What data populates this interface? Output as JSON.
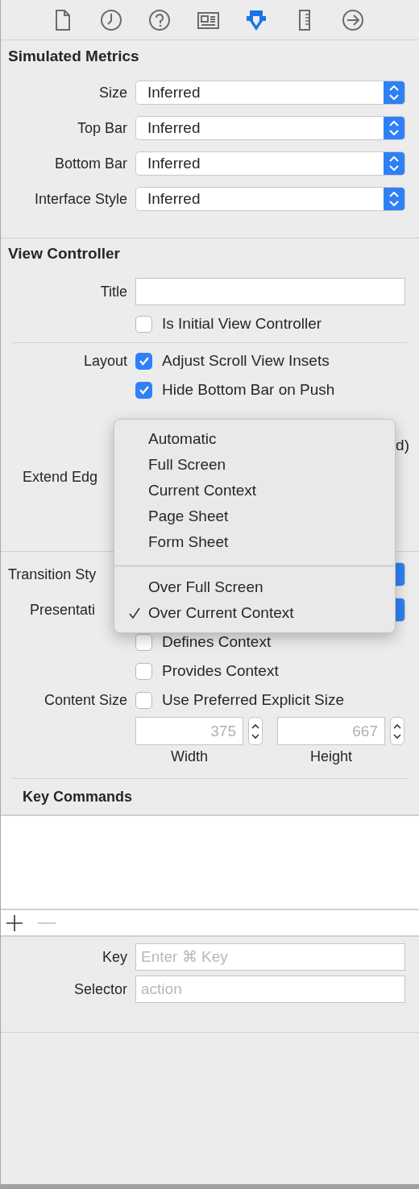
{
  "toolbar": [
    {
      "kind": "file",
      "selected": false
    },
    {
      "kind": "clock",
      "selected": false
    },
    {
      "kind": "help",
      "selected": false
    },
    {
      "kind": "identity",
      "selected": false
    },
    {
      "kind": "attributes",
      "selected": true
    },
    {
      "kind": "ruler",
      "selected": false
    },
    {
      "kind": "connections",
      "selected": false
    }
  ],
  "simulated_metrics": {
    "title": "Simulated Metrics",
    "rows": [
      {
        "label": "Size",
        "value": "Inferred"
      },
      {
        "label": "Top Bar",
        "value": "Inferred"
      },
      {
        "label": "Bottom Bar",
        "value": "Inferred"
      },
      {
        "label": "Interface Style",
        "value": "Inferred"
      }
    ]
  },
  "view_controller": {
    "title": "View Controller",
    "title_field": {
      "label": "Title"
    },
    "initial": {
      "label": "Is Initial View Controller",
      "checked": false
    },
    "layout": {
      "label": "Layout",
      "options": [
        {
          "label": "Adjust Scroll View Insets",
          "checked": true
        },
        {
          "label": "Hide Bottom Bar on Push",
          "checked": true
        }
      ]
    },
    "extend_edges": {
      "label": "Extend Edg",
      "option_fragment": "d)"
    },
    "transition_style": {
      "label": "Transition Sty"
    },
    "presentation": {
      "label": "Presentati"
    },
    "context": [
      {
        "label": "Defines Context",
        "checked": false
      },
      {
        "label": "Provides Context",
        "checked": false
      }
    ],
    "content_size": {
      "label": "Content Size",
      "option": {
        "label": "Use Preferred Explicit Size",
        "checked": false
      },
      "width": {
        "placeholder": "375",
        "label": "Width"
      },
      "height": {
        "placeholder": "667",
        "label": "Height"
      }
    }
  },
  "key_commands": {
    "title": "Key Commands",
    "list_buttons": [
      {
        "kind": "add",
        "disabled": false
      },
      {
        "kind": "remove",
        "disabled": true
      }
    ],
    "key": {
      "label": "Key",
      "placeholder": "Enter ⌘ Key"
    },
    "selector": {
      "label": "Selector",
      "placeholder": "action"
    }
  },
  "menu": {
    "groups": [
      {
        "items": [
          {
            "label": "Automatic",
            "selected": false
          },
          {
            "label": "Full Screen",
            "selected": false
          },
          {
            "label": "Current Context",
            "selected": false
          },
          {
            "label": "Page Sheet",
            "selected": false
          },
          {
            "label": "Form Sheet",
            "selected": false
          }
        ]
      },
      {
        "items": [
          {
            "label": "Over Full Screen",
            "selected": false
          },
          {
            "label": "Over Current Context",
            "selected": true
          }
        ]
      }
    ]
  }
}
